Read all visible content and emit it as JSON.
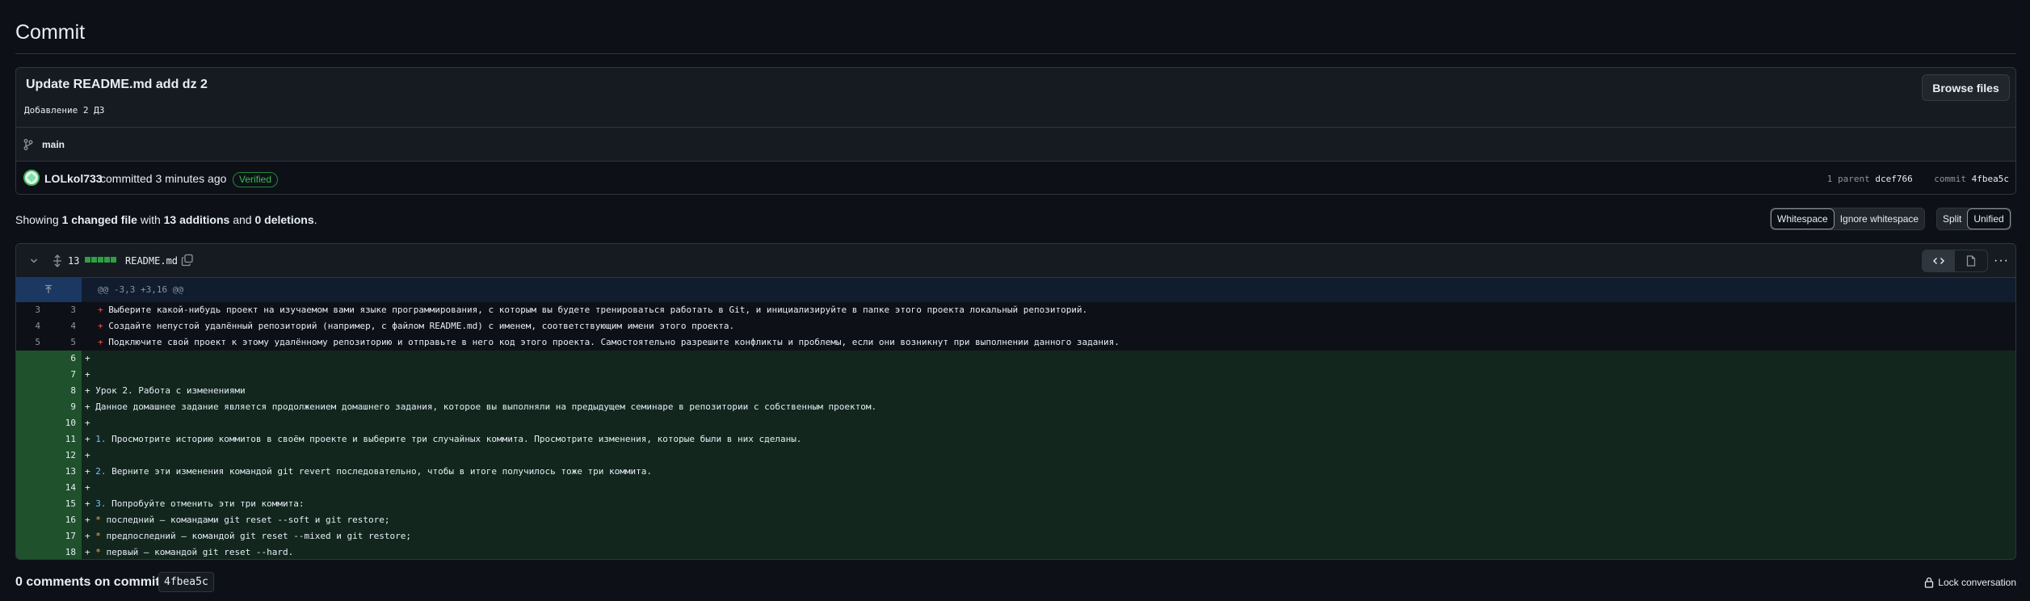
{
  "page": {
    "title": "Commit"
  },
  "commit": {
    "title": "Update README.md add dz 2",
    "description": "Добавление 2 ДЗ",
    "browse_label": "Browse files",
    "branch": "main",
    "author": "LOLkol733",
    "action": "committed 3 minutes ago",
    "verified": "Verified",
    "parent_label": "1 parent",
    "parent_sha": "dcef766",
    "commit_label": "commit",
    "commit_sha": "4fbea5c"
  },
  "summary": {
    "prefix": "Showing",
    "files": "1 changed file",
    "with": "with",
    "additions": "13 additions",
    "and": "and",
    "deletions": "0 deletions",
    "suffix": ".",
    "whitespace": "Whitespace",
    "ignore_whitespace": "Ignore whitespace",
    "split": "Split",
    "unified": "Unified"
  },
  "file": {
    "change_count": "13",
    "name": "README.md"
  },
  "hunk": "@@ -3,3 +3,16 @@",
  "context_lines": [
    {
      "old": "3",
      "new": "3",
      "text": "Выберите какой-нибудь проект на изучаемом вами языке программирования, с которым вы будете тренироваться работать в Git, и инициализируйте в папке этого проекта локальный репозиторий."
    },
    {
      "old": "4",
      "new": "4",
      "text": "Создайте непустой удалённый репозиторий (например, с файлом README.md) с именем, соответствующим имени этого проекта."
    },
    {
      "old": "5",
      "new": "5",
      "text": "Подключите свой проект к этому удалённому репозиторию и отправьте в него код этого проекта. Самостоятельно разрешите конфликты и проблемы, если они возникнут при выполнении данного задания."
    }
  ],
  "added_lines": [
    {
      "new": "6",
      "text": ""
    },
    {
      "new": "7",
      "text": ""
    },
    {
      "new": "8",
      "text": "Урок 2. Работа с изменениями"
    },
    {
      "new": "9",
      "text": "Данное домашнее задание является продолжением домашнего задания, которое вы выполняли на предыдущем семинаре в репозитории с собственным проектом."
    },
    {
      "new": "10",
      "text": ""
    },
    {
      "new": "11",
      "num": "1.",
      "text": " Просмотрите историю коммитов в своём проекте и выберите три случайных коммита. Просмотрите изменения, которые были в них сделаны."
    },
    {
      "new": "12",
      "text": ""
    },
    {
      "new": "13",
      "num": "2.",
      "text": " Верните эти изменения командой git revert последовательно, чтобы в итоге получилось тоже три коммита."
    },
    {
      "new": "14",
      "text": ""
    },
    {
      "new": "15",
      "num": "3.",
      "text": " Попробуйте отменить эти три коммита:"
    },
    {
      "new": "16",
      "star": "*",
      "text": " последний — командами git reset --soft и git restore;"
    },
    {
      "new": "17",
      "star": "*",
      "text": " предпоследний — командой git reset --mixed и git restore;"
    },
    {
      "new": "18",
      "star": "*",
      "text": " первый — командой git reset --hard."
    }
  ],
  "comments": {
    "label": "0 comments on commit",
    "sha": "4fbea5c",
    "lock_label": "Lock conversation"
  },
  "icons": {
    "branch": "git-branch-icon",
    "chevron": "chevron-down-icon",
    "copy": "copy-icon",
    "lock": "lock-icon"
  },
  "colors": {
    "background": "#0d1117",
    "addition": "#2ea043",
    "deletion_marker": "#f85149",
    "verified": "#3fb950"
  }
}
